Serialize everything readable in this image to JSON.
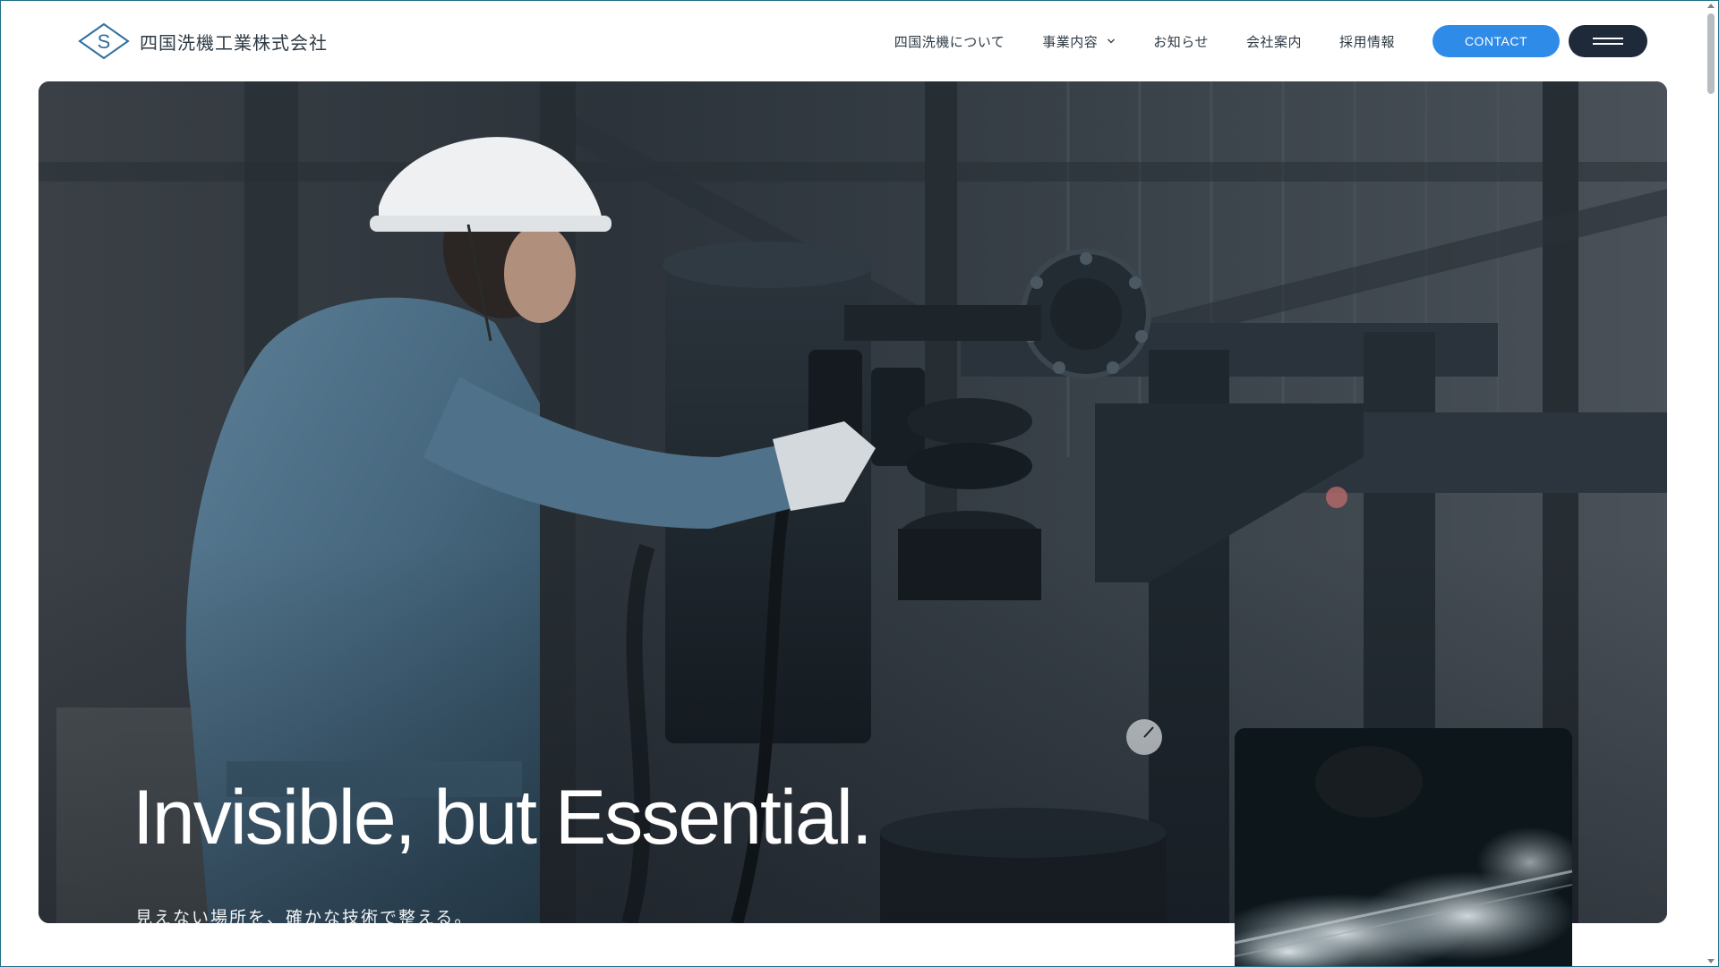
{
  "header": {
    "logo_letter": "S",
    "logo_text": "四国洗機工業株式会社",
    "nav": [
      {
        "label": "四国洗機について",
        "has_dropdown": false
      },
      {
        "label": "事業内容",
        "has_dropdown": true
      },
      {
        "label": "お知らせ",
        "has_dropdown": false
      },
      {
        "label": "会社案内",
        "has_dropdown": false
      },
      {
        "label": "採用情報",
        "has_dropdown": false
      }
    ],
    "contact_label": "CONTACT",
    "menu_icon": "hamburger-icon"
  },
  "hero": {
    "title": "Invisible, but Essential.",
    "subtitle": "見えない場所を、確かな技術で整える。",
    "image": "worker-in-hard-hat-operating-industrial-valves"
  },
  "thumbnail": {
    "image": "steam-rising-from-pipe-in-dark"
  },
  "colors": {
    "accent": "#2f8be8",
    "menu_button": "#1e2a3a",
    "logo": "#2f6f9e",
    "text": "#2e3a44"
  }
}
